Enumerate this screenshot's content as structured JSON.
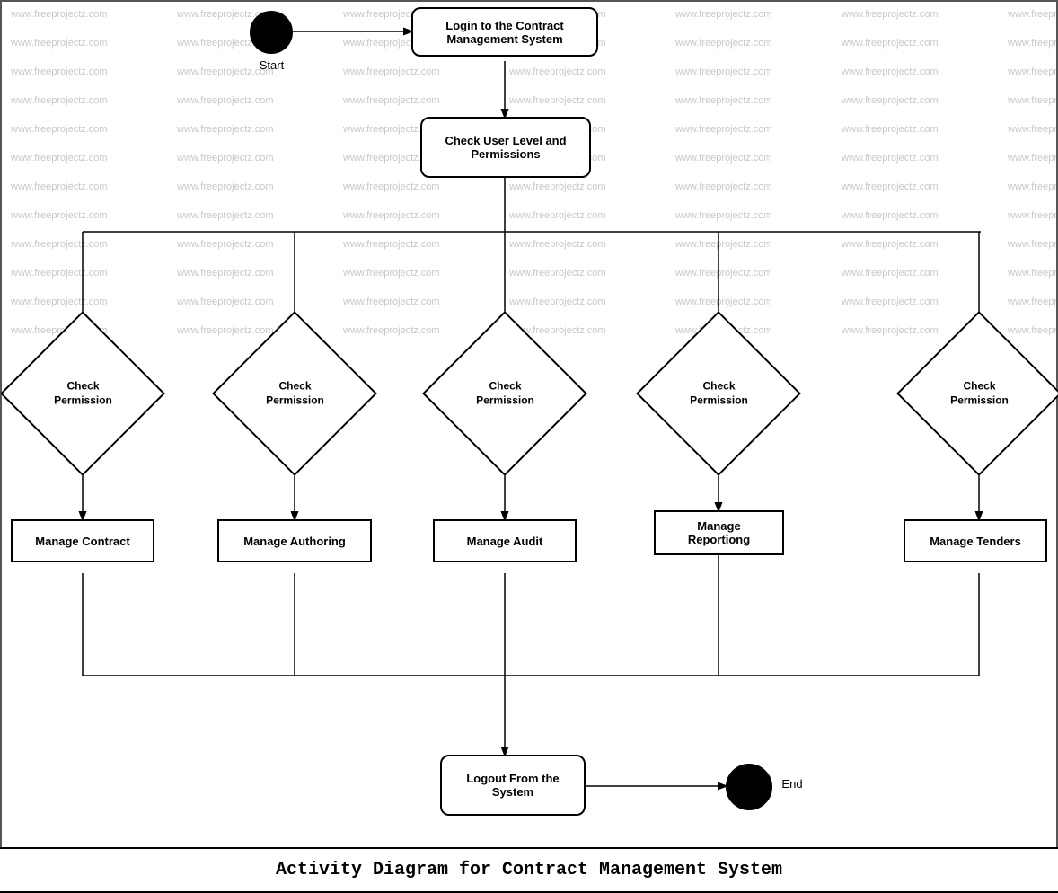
{
  "diagram": {
    "title": "Activity Diagram for Contract Management System",
    "watermark_text": "www.freeprojectz.com",
    "nodes": {
      "start_label": "Start",
      "end_label": "End",
      "login": "Login to the Contract\nManagement System",
      "check_user_level": "Check User Level and\nPermissions",
      "check_perm_1": "Check\nPermission",
      "check_perm_2": "Check\nPermission",
      "check_perm_3": "Check\nPermission",
      "check_perm_4": "Check\nPermission",
      "check_perm_5": "Check\nPermission",
      "manage_contract": "Manage Contract",
      "manage_authoring": "Manage Authoring",
      "manage_audit": "Manage Audit",
      "manage_reportiong": "Manage Reportiong",
      "manage_tenders": "Manage Tenders",
      "logout": "Logout From the\nSystem"
    }
  }
}
